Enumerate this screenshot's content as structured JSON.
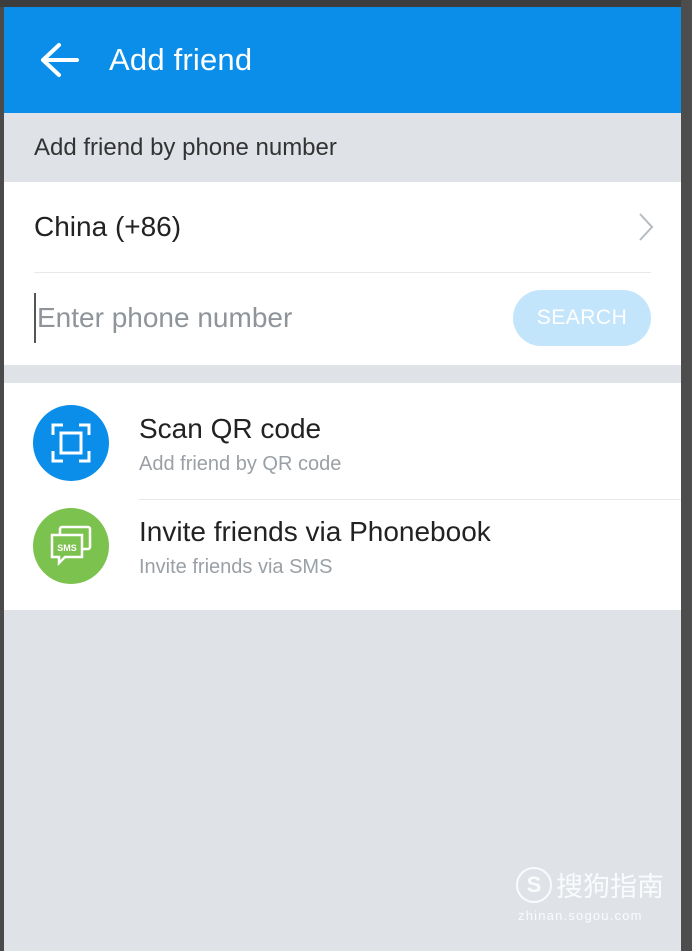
{
  "header": {
    "title": "Add friend",
    "back_icon": "arrow-left-icon",
    "background": "#0a8ee9"
  },
  "phone_section": {
    "label": "Add friend by phone number",
    "country": "China (+86)",
    "country_icon": "chevron-right-icon",
    "phone_placeholder": "Enter phone number",
    "phone_value": "",
    "search_label": "SEARCH"
  },
  "options": [
    {
      "title": "Scan QR code",
      "subtitle": "Add friend by QR code",
      "icon": "qr-scan-icon",
      "icon_color": "#0a8ee9"
    },
    {
      "title": "Invite friends via Phonebook",
      "subtitle": "Invite friends via SMS",
      "icon": "sms-icon",
      "icon_color": "#7cc24e",
      "icon_text": "SMS"
    }
  ],
  "watermark": {
    "logo_letter": "S",
    "name": "搜狗指南",
    "url": "zhinan.sogou.com"
  }
}
